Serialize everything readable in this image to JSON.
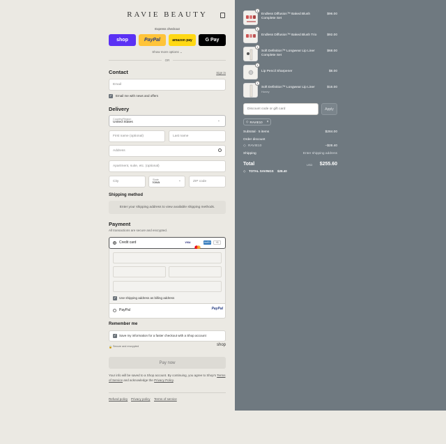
{
  "header": {
    "brand": "RAVIE BEAUTY"
  },
  "express": {
    "title": "Express checkout",
    "shop": "shop",
    "paypal": "PayPal",
    "amazon": "amazon pay",
    "gpay": "G Pay",
    "more": "Show more options",
    "or": "OR"
  },
  "contact": {
    "title": "Contact",
    "signin": "Sign in",
    "email_placeholder": "Email",
    "news_label": "Email me with news and offers"
  },
  "delivery": {
    "title": "Delivery",
    "country_label": "Country/Region",
    "country_value": "United States",
    "first_name": "First name (optional)",
    "last_name": "Last name",
    "address": "Address",
    "apartment": "Apartment, suite, etc. (optional)",
    "city": "City",
    "state_label": "State",
    "state_value": "Iowa",
    "zip": "ZIP code"
  },
  "shipping": {
    "title": "Shipping method",
    "message": "Enter your shipping address to view available shipping methods."
  },
  "payment": {
    "title": "Payment",
    "subtitle": "All transactions are secure and encrypted.",
    "credit_card": "Credit card",
    "visa": "VISA",
    "amex": "AMEX",
    "more_cards": "+5",
    "billing_label": "Use shipping address as billing address",
    "paypal_label": "PayPal",
    "paypal_logo": "PayPal"
  },
  "remember": {
    "title": "Remember me",
    "save_label": "Save my information for a faster checkout with a Shop account",
    "secure": "Secure and encrypted",
    "shop_logo": "shop"
  },
  "pay_now": "Pay now",
  "legal": {
    "line1": "Your info will be saved to a Shop account. By continuing, you agree to Shop's",
    "terms": "Terms of Service",
    "and": "and acknowledge the",
    "privacy": "Privacy Policy",
    "end": "."
  },
  "footer": {
    "refund": "Refund policy",
    "privacy": "Privacy policy",
    "terms": "Terms of service"
  },
  "order": {
    "items": [
      {
        "name": "Endless Diffusion™ Baked Blush Complete Set",
        "variant": "",
        "price": "$96.00",
        "qty": "1"
      },
      {
        "name": "Endless Diffusion™ Baked Blush Trio",
        "variant": "",
        "price": "$92.00",
        "qty": "1"
      },
      {
        "name": "Soft Definition™ Longwear Lip Liner Complete Set",
        "variant": "",
        "price": "$68.00",
        "qty": "1"
      },
      {
        "name": "Lip Pencil Sharpener",
        "variant": "",
        "price": "$8.00",
        "qty": "1"
      },
      {
        "name": "Soft Definition™ Longwear Lip Liner",
        "variant": "Honey",
        "price": "$16.00",
        "qty": "1"
      }
    ],
    "discount_placeholder": "Discount code or gift card",
    "apply": "Apply",
    "code_chip": "RAVIE10",
    "subtotal_label": "Subtotal · 5 items",
    "subtotal_value": "$284.00",
    "order_discount_label": "Order discount",
    "discount_code": "RAVIE10",
    "discount_value": "−$28.40",
    "shipping_label": "Shipping",
    "shipping_value": "Enter shipping address",
    "total_label": "Total",
    "currency": "USD",
    "total_value": "$255.60",
    "savings_label": "TOTAL SAVINGS",
    "savings_value": "$28.40"
  },
  "colors": {
    "accent_shop": "#5a31f4",
    "paypal": "#ffc439",
    "amazon": "#ffd814",
    "sidebar": "#6f7980"
  }
}
